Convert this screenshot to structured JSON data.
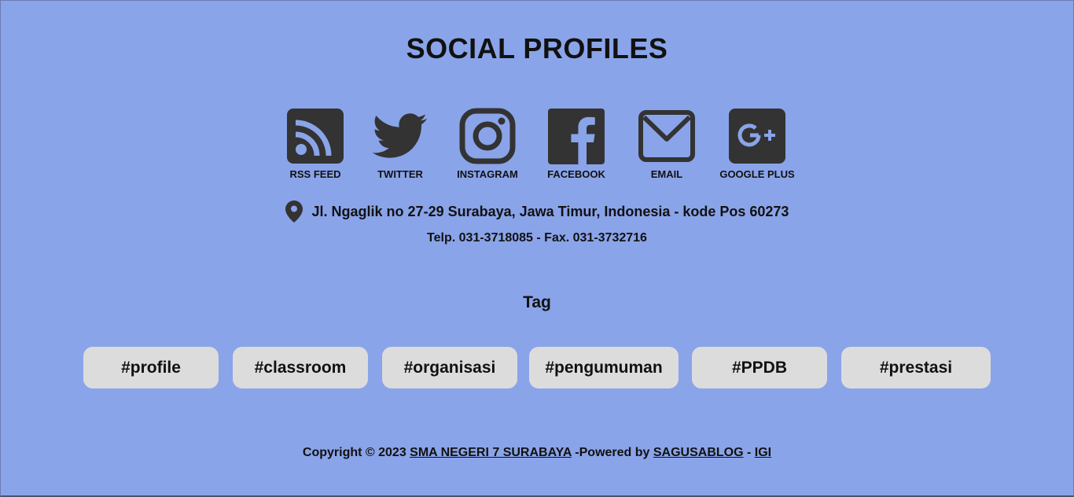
{
  "colors": {
    "background": "#8aa4e9",
    "icon": "#333333",
    "tag_background": "#dcdcdc",
    "text": "#111111"
  },
  "section_title": "SOCIAL PROFILES",
  "social": [
    {
      "label": "RSS FEED",
      "icon": "rss-icon"
    },
    {
      "label": "TWITTER",
      "icon": "twitter-icon"
    },
    {
      "label": "INSTAGRAM",
      "icon": "instagram-icon"
    },
    {
      "label": "FACEBOOK",
      "icon": "facebook-icon"
    },
    {
      "label": "EMAIL",
      "icon": "email-icon"
    },
    {
      "label": "GOOGLE PLUS",
      "icon": "google-plus-icon"
    }
  ],
  "address": {
    "icon": "map-pin-icon",
    "text": "Jl. Ngaglik no 27-29 Surabaya, Jawa Timur, Indonesia - kode Pos 60273",
    "phone": "Telp. 031-3718085 - Fax. 031-3732716"
  },
  "tags": {
    "title": "Tag",
    "items": [
      "#profile",
      "#classroom",
      "#organisasi",
      "#pengumuman",
      "#PPDB",
      "#prestasi"
    ]
  },
  "footer": {
    "copyright_prefix": "Copyright © 2023 ",
    "school_link": "SMA NEGERI 7 SURABAYA",
    "powered_by": " -Powered by ",
    "platform_link": "SAGUSABLOG",
    "separator": " - ",
    "igi_link": "IGI"
  }
}
